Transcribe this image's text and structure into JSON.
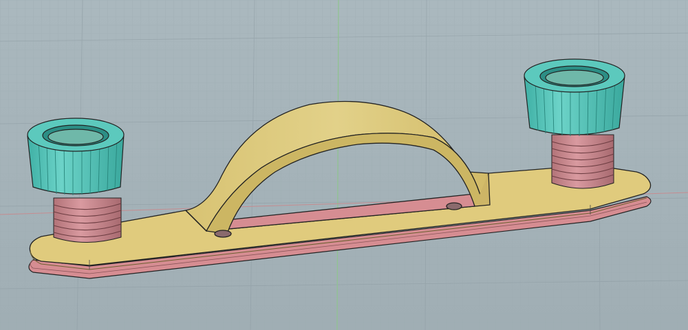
{
  "viewport": {
    "grid_visible": true,
    "axes_visible": true
  },
  "colors": {
    "background_top": "#aab8be",
    "background_bottom": "#a2b0b6",
    "grid_minor": "#9eacb2",
    "grid_major": "#8e9ca3",
    "axis_x": "#c98f93",
    "axis_y": "#94bf94",
    "bracket_body": "#dcc878",
    "bracket_side": "#c9b05c",
    "bracket_top": "#e6d690",
    "base_plate": "#d98f94",
    "base_plate_dark": "#c27b80",
    "thread": "#c98a8f",
    "thread_dark": "#a86a70",
    "knob": "#52c3b8",
    "knob_dark": "#2d9a90",
    "knob_light": "#7ad6cc",
    "outline": "#1f1f1f"
  },
  "model": {
    "parts": [
      {
        "name": "cable-clamp-saddle",
        "material_color": "bracket_body"
      },
      {
        "name": "base-plate",
        "material_color": "base_plate"
      },
      {
        "name": "left-threaded-stud",
        "material_color": "thread"
      },
      {
        "name": "right-threaded-stud",
        "material_color": "thread"
      },
      {
        "name": "left-knurled-nut",
        "material_color": "knob"
      },
      {
        "name": "right-knurled-nut",
        "material_color": "knob"
      }
    ]
  }
}
